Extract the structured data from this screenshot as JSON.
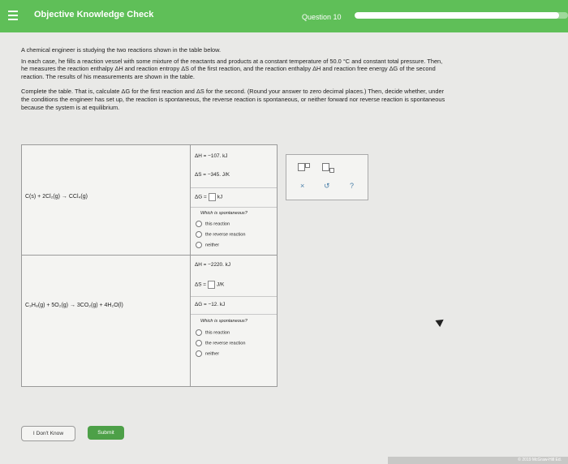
{
  "header": {
    "app_title": "Objective Knowledge Check",
    "question_label": "Question 10",
    "progress_percent": 96
  },
  "intro": {
    "line1": "A chemical engineer is studying the two reactions shown in the table below.",
    "para2_line1": "In each case, he fills a reaction vessel with some mixture of the reactants and products at a constant temperature of 50.0 °C and constant total pressure. Then,",
    "para2_line2": "he measures the reaction enthalpy ΔH and reaction entropy ΔS of the first reaction, and the reaction enthalpy ΔH and reaction free energy ΔG of the second",
    "para2_line3": "reaction. The results of his measurements are shown in the table.",
    "para3_line1": "Complete the table. That is, calculate ΔG for the first reaction and ΔS for the second. (Round your answer to zero decimal places.) Then, decide whether, under",
    "para3_line2": "the conditions the engineer has set up, the reaction is spontaneous, the reverse reaction is spontaneous, or neither forward nor reverse reaction is spontaneous",
    "para3_line3": "because the system is at equilibrium."
  },
  "reactions": [
    {
      "equation": "C(s) + 2Cl₂(g) → CCl₄(g)",
      "dH": "ΔH = −107. kJ",
      "dS": "ΔS = −345.",
      "dS_unit": "J/K",
      "dG": "ΔG =",
      "dG_unit": "kJ",
      "question": "Which is spontaneous?",
      "options": [
        "this reaction",
        "the reverse reaction",
        "neither"
      ]
    },
    {
      "equation": "C₃H₈(g) + 5O₂(g) → 3CO₂(g) + 4H₂O(l)",
      "dH": "ΔH = −2220. kJ",
      "dS": "ΔS =",
      "dS_unit": "J/K",
      "dG": "ΔG = −12. kJ",
      "question": "Which is spontaneous?",
      "options": [
        "this reaction",
        "the reverse reaction",
        "neither"
      ]
    }
  ],
  "tools": {
    "clear_symbol": "×",
    "undo_symbol": "↺",
    "help_symbol": "?"
  },
  "footer": {
    "dont_know": "I Don't Know",
    "submit": "Submit",
    "copyright": "© 2019 McGraw-Hill Ed."
  }
}
